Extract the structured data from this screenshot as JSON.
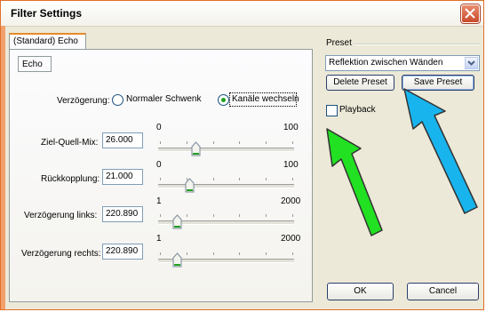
{
  "window": {
    "title": "Filter Settings"
  },
  "tabs": {
    "main": "(Standard) Echo",
    "sub": "Echo"
  },
  "delay": {
    "label": "Verzögerung:",
    "option1": "Normaler Schwenk",
    "option2": "Kanäle wechseln",
    "selected": "option2"
  },
  "sliders": [
    {
      "label": "Ziel-Quell-Mix:",
      "value": "26.000",
      "min": "0",
      "max": "100",
      "fraction": 0.26
    },
    {
      "label": "Rückkopplung:",
      "value": "21.000",
      "min": "0",
      "max": "100",
      "fraction": 0.21
    },
    {
      "label": "Verzögerung links:",
      "value": "220.890",
      "min": "1",
      "max": "2000",
      "fraction": 0.11
    },
    {
      "label": "Verzögerung rechts:",
      "value": "220.890",
      "min": "1",
      "max": "2000",
      "fraction": 0.11
    }
  ],
  "preset": {
    "group_label": "Preset",
    "selected": "Reflektion zwischen Wänden",
    "delete_label": "Delete Preset",
    "save_label": "Save Preset"
  },
  "playback": {
    "label": "Playback",
    "checked": false
  },
  "buttons": {
    "ok": "OK",
    "cancel": "Cancel"
  },
  "colors": {
    "title_accent": "#e06f2a",
    "green_arrow": "#22e022",
    "blue_arrow": "#18b4ee",
    "radio_dot": "#21a121"
  }
}
